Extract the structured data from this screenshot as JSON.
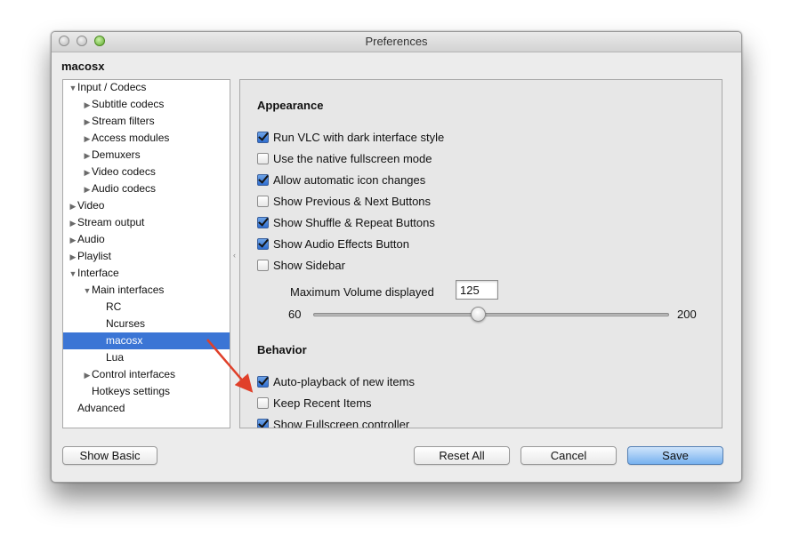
{
  "window": {
    "title": "Preferences",
    "section": "macosx"
  },
  "tree": [
    {
      "label": "Input / Codecs",
      "level": 0,
      "arrow": "▼",
      "selected": false
    },
    {
      "label": "Subtitle codecs",
      "level": 1,
      "arrow": "▶",
      "selected": false
    },
    {
      "label": "Stream filters",
      "level": 1,
      "arrow": "▶",
      "selected": false
    },
    {
      "label": "Access modules",
      "level": 1,
      "arrow": "▶",
      "selected": false
    },
    {
      "label": "Demuxers",
      "level": 1,
      "arrow": "▶",
      "selected": false
    },
    {
      "label": "Video codecs",
      "level": 1,
      "arrow": "▶",
      "selected": false
    },
    {
      "label": "Audio codecs",
      "level": 1,
      "arrow": "▶",
      "selected": false
    },
    {
      "label": "Video",
      "level": 0,
      "arrow": "▶",
      "selected": false
    },
    {
      "label": "Stream output",
      "level": 0,
      "arrow": "▶",
      "selected": false
    },
    {
      "label": "Audio",
      "level": 0,
      "arrow": "▶",
      "selected": false
    },
    {
      "label": "Playlist",
      "level": 0,
      "arrow": "▶",
      "selected": false
    },
    {
      "label": "Interface",
      "level": 0,
      "arrow": "▼",
      "selected": false
    },
    {
      "label": "Main interfaces",
      "level": 1,
      "arrow": "▼",
      "selected": false
    },
    {
      "label": "RC",
      "level": 2,
      "arrow": "",
      "selected": false
    },
    {
      "label": "Ncurses",
      "level": 2,
      "arrow": "",
      "selected": false
    },
    {
      "label": "macosx",
      "level": 2,
      "arrow": "",
      "selected": true
    },
    {
      "label": "Lua",
      "level": 2,
      "arrow": "",
      "selected": false
    },
    {
      "label": "Control interfaces",
      "level": 1,
      "arrow": "▶",
      "selected": false
    },
    {
      "label": "Hotkeys settings",
      "level": 1,
      "arrow": "",
      "selected": false
    },
    {
      "label": "Advanced",
      "level": 0,
      "arrow": "",
      "selected": false
    }
  ],
  "appearance": {
    "heading": "Appearance",
    "options": [
      {
        "label": "Run VLC with dark interface style",
        "checked": true
      },
      {
        "label": "Use the native fullscreen mode",
        "checked": false
      },
      {
        "label": "Allow automatic icon changes",
        "checked": true
      },
      {
        "label": "Show Previous & Next Buttons",
        "checked": false
      },
      {
        "label": "Show Shuffle & Repeat Buttons",
        "checked": true
      },
      {
        "label": "Show Audio Effects Button",
        "checked": true
      },
      {
        "label": "Show Sidebar",
        "checked": false
      }
    ],
    "volume_label": "Maximum Volume displayed",
    "volume_value": "125",
    "slider_min": "60",
    "slider_max": "200",
    "slider_value": 125
  },
  "behavior": {
    "heading": "Behavior",
    "options": [
      {
        "label": "Auto-playback of new items",
        "checked": true
      },
      {
        "label": "Keep Recent Items",
        "checked": false
      },
      {
        "label": "Show Fullscreen controller",
        "checked": true
      }
    ]
  },
  "buttons": {
    "show_basic": "Show Basic",
    "reset_all": "Reset All",
    "cancel": "Cancel",
    "save": "Save"
  },
  "colors": {
    "selection": "#3b75d5",
    "annotation_arrow": "#e0402a",
    "default_button": "#77b1ef"
  }
}
